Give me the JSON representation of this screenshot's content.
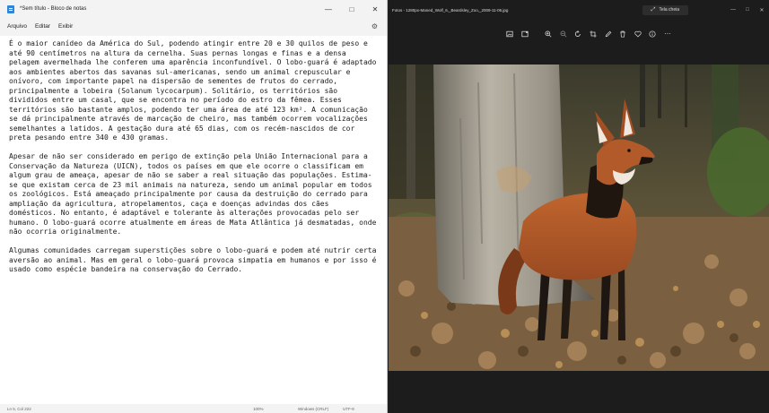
{
  "notepad": {
    "title": "*Sem título - Bloco de notas",
    "menu": [
      "Arquivo",
      "Editar",
      "Exibir"
    ],
    "paragraphs": [
      "É o maior canídeo da América do Sul, podendo atingir entre 20 e 30 quilos de peso e até 90 centímetros na altura da cernelha. Suas pernas longas e finas e a densa pelagem avermelhada lhe conferem uma aparência inconfundível. O lobo-guará é adaptado aos ambientes abertos das savanas sul-americanas, sendo um animal crepuscular e onívoro, com importante papel na dispersão de sementes de frutos do cerrado, principalmente a lobeira (Solanum lycocarpum). Solitário, os territórios são divididos entre um casal, que se encontra no período do estro da fêmea. Esses territórios são bastante amplos, podendo ter uma área de até 123 km². A comunicação se dá principalmente através de marcação de cheiro, mas também ocorrem vocalizações semelhantes a latidos. A gestação dura até 65 dias, com os recém-nascidos de cor preta pesando entre 340 e 430 gramas.",
      "Apesar de não ser considerado em perigo de extinção pela União Internacional para a Conservação da Natureza (UICN), todos os países em que ele ocorre o classificam em algum grau de ameaça, apesar de não se saber a real situação das populações. Estima-se que existam cerca de 23 mil animais na natureza, sendo um animal popular em todos os zoológicos. Está ameaçado principalmente por causa da destruição do cerrado para ampliação da agricultura, atropelamentos, caça e doenças advindas dos cães domésticos. No entanto, é adaptável e tolerante às alterações provocadas pelo ser humano. O lobo-guará ocorre atualmente em áreas de Mata Atlântica já desmatadas, onde não ocorria originalmente.",
      "Algumas comunidades carregam superstições sobre o lobo-guará e podem até nutrir certa aversão ao animal. Mas em geral o lobo-guará provoca simpatia em humanos e por isso é usado como espécie bandeira na conservação do Cerrado."
    ],
    "status": {
      "position": "Ln 5, Col 222",
      "zoom": "100%",
      "line_ending": "Windows (CRLF)",
      "encoding": "UTF-8"
    }
  },
  "photos": {
    "title": "Fotos - 1280px-Maned_Wolf_6,_Beardsley_Zoo,_2009-11-06.jpg",
    "fullscreen_label": "Tela cheia",
    "toolbar_icons": [
      "image-icon",
      "adjust-icon",
      "zoom-in-icon",
      "zoom-out-icon",
      "rotate-icon",
      "crop-icon",
      "draw-icon",
      "delete-icon",
      "favorite-icon",
      "info-icon",
      "more-icon"
    ],
    "photo_subject": "maned-wolf"
  },
  "colors": {
    "notepad_bg": "#ffffff",
    "chrome_light": "#f3f3f3",
    "photos_bg": "#1c1c1c",
    "wolf_fur": "#b5582a"
  }
}
